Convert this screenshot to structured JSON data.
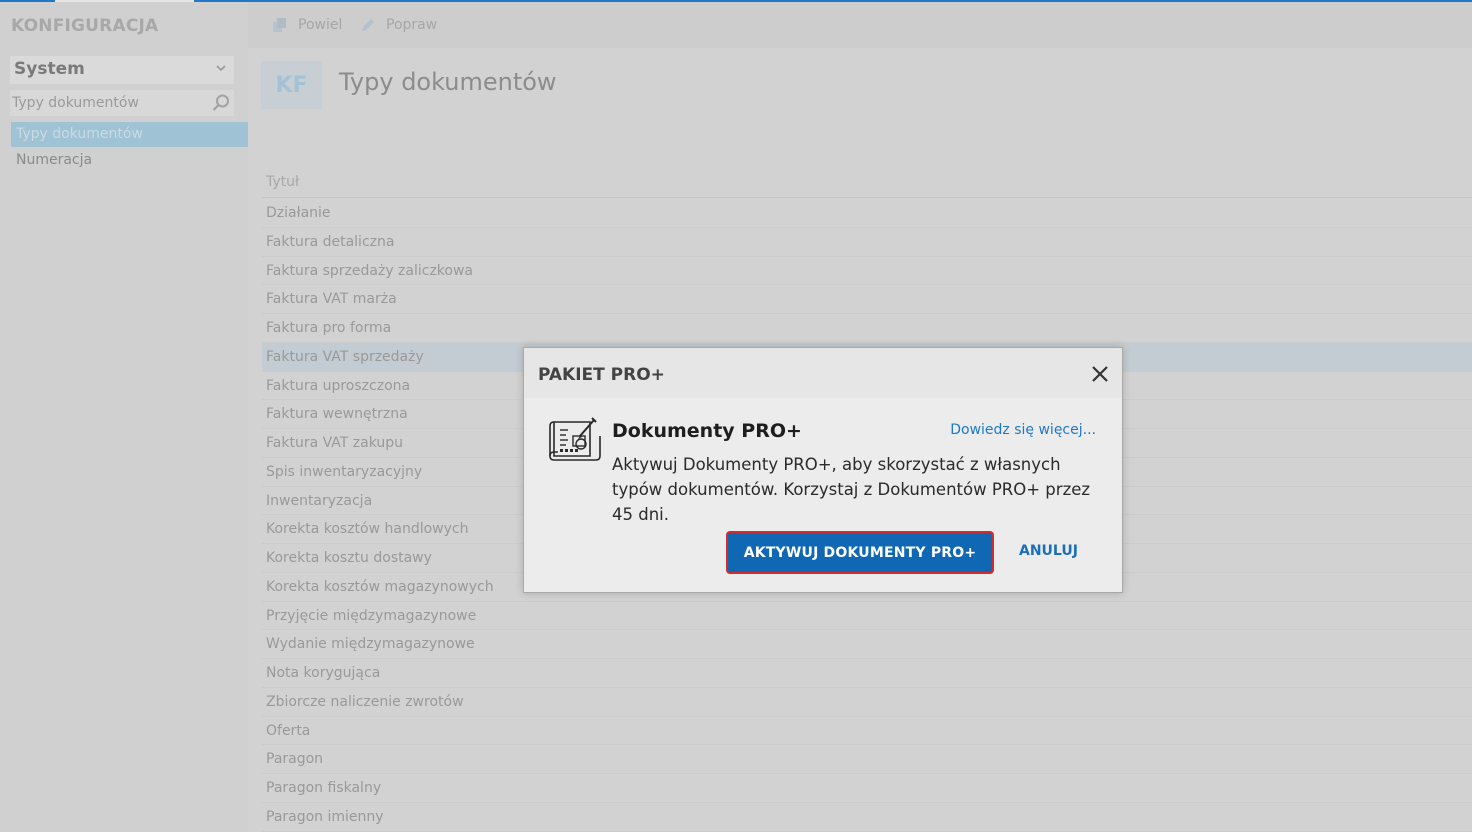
{
  "app": {
    "title": "KONFIGURACJA"
  },
  "sidebar": {
    "section": "System",
    "search_placeholder": "Typy dokumentów",
    "items": [
      {
        "label": "Typy dokumentów",
        "active": true
      },
      {
        "label": "Numeracja",
        "active": false
      }
    ]
  },
  "toolbar": {
    "duplicate_label": "Powiel",
    "edit_label": "Popraw"
  },
  "header": {
    "badge": "KF",
    "title": "Typy dokumentów"
  },
  "list": {
    "column_title": "Tytuł",
    "rows": [
      "Działanie",
      "Faktura detaliczna",
      "Faktura sprzedaży zaliczkowa",
      "Faktura VAT marża",
      "Faktura pro forma",
      "Faktura VAT sprzedaży",
      "Faktura uproszczona",
      "Faktura wewnętrzna",
      "Faktura VAT zakupu",
      "Spis inwentaryzacyjny",
      "Inwentaryzacja",
      "Korekta kosztów handlowych",
      "Korekta kosztu dostawy",
      "Korekta kosztów magazynowych",
      "Przyjęcie międzymagazynowe",
      "Wydanie międzymagazynowe",
      "Nota korygująca",
      "Zbiorcze naliczenie zwrotów",
      "Oferta",
      "Paragon",
      "Paragon fiskalny",
      "Paragon imienny"
    ],
    "selected_row": "Faktura VAT sprzedaży"
  },
  "modal": {
    "title": "PAKIET PRO+",
    "product": "Dokumenty PRO+",
    "learn_more": "Dowiedz się więcej...",
    "description": "Aktywuj Dokumenty PRO+, aby skorzystać z własnych typów dokumentów. Korzystaj z Dokumentów PRO+ przez 45 dni.",
    "activate_label": "AKTYWUJ DOKUMENTY PRO+",
    "cancel_label": "ANULUJ"
  },
  "colors": {
    "accent": "#1068b4",
    "highlight_border": "#d42b2b",
    "link": "#1e78c8"
  }
}
